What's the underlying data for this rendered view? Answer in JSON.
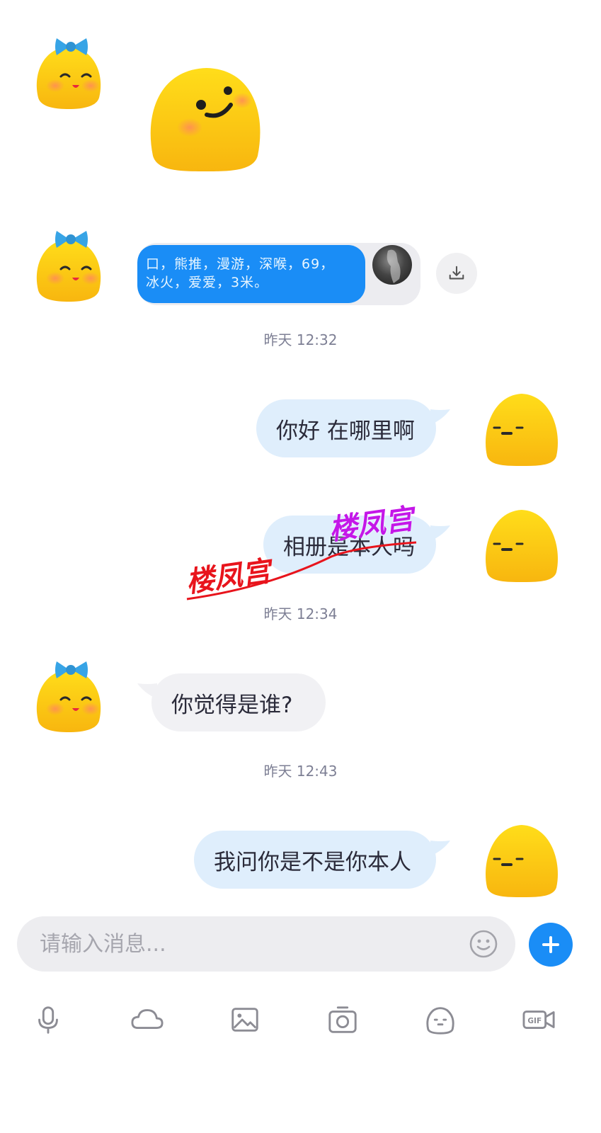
{
  "messages": {
    "shared_card": {
      "lines": [
        "口，熊推，漫游，深喉，69，",
        "冰火，爱爱，3米。"
      ]
    },
    "time_1": "昨天 12:32",
    "me_1": "你好 在哪里啊",
    "me_2": "相册是本人吗",
    "time_2": "昨天 12:34",
    "them_1": "你觉得是谁?",
    "time_3": "昨天 12:43",
    "me_3": "我问你是不是你本人"
  },
  "watermark": {
    "text_1": "楼凤宫",
    "text_2": "楼凤宫",
    "colors": {
      "red": "#e8141c",
      "purple": "#c417e8"
    }
  },
  "input": {
    "placeholder": "请输入消息..."
  },
  "toolbar": {
    "icons": [
      "microphone-icon",
      "cloud-icon",
      "image-icon",
      "camera-icon",
      "sticker-face-icon",
      "gif-icon"
    ]
  },
  "colors": {
    "accent": "#1a8df6",
    "my_bubble": "#dfeefc",
    "their_bubble": "#f1f1f4",
    "avatar_yellow": "#fdc80e",
    "bow_blue": "#37a4e6"
  }
}
